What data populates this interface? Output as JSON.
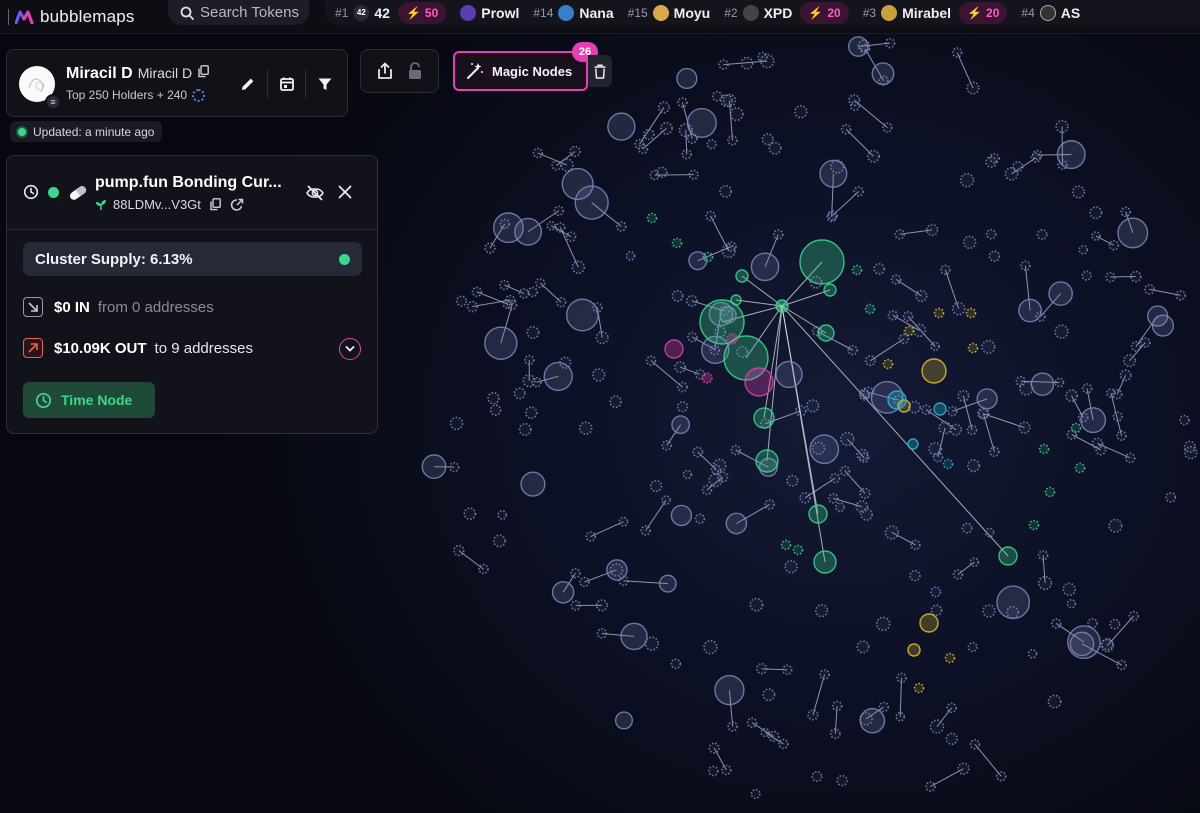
{
  "brand": {
    "name": "bubblemaps"
  },
  "search": {
    "placeholder": "Search Tokens"
  },
  "trending": [
    {
      "rank": "#1",
      "name": "42",
      "icon_text": "42",
      "icon_color": "#2a2a33",
      "boost": "50"
    },
    {
      "rank": "",
      "name": "Prowl",
      "icon_text": "",
      "icon_color": "#5b3fb0",
      "boost": ""
    },
    {
      "rank": "#14",
      "name": "Nana",
      "icon_text": "",
      "icon_color": "#3a7fc8",
      "boost": ""
    },
    {
      "rank": "#15",
      "name": "Moyu",
      "icon_text": "",
      "icon_color": "#d8a84a",
      "boost": ""
    },
    {
      "rank": "#2",
      "name": "XPD",
      "icon_text": "",
      "icon_color": "#444",
      "boost": "20"
    },
    {
      "rank": "#3",
      "name": "Mirabel",
      "icon_text": "",
      "icon_color": "#c8a040",
      "boost": "20"
    },
    {
      "rank": "#4",
      "name": "AS",
      "icon_text": "",
      "icon_color": "#333",
      "boost": ""
    }
  ],
  "token": {
    "name": "Miracil D",
    "symbol": "Miracil D",
    "subtitle": "Top 250 Holders + 240"
  },
  "updated": {
    "text": "Updated: a minute ago"
  },
  "magic_nodes": {
    "label": "Magic Nodes",
    "count": "26"
  },
  "wallet": {
    "title": "pump.fun Bonding Cur...",
    "address": "88LDMv...V3Gt",
    "cluster_supply": "Cluster Supply: 6.13%",
    "in_amount": "$0 IN",
    "in_rest": "from 0 addresses",
    "out_amount": "$10.09K OUT",
    "out_rest": "to 9 addresses",
    "time_node_label": "Time Node"
  },
  "colors": {
    "accent_pink": "#e53fb4",
    "green": "#3dd68c",
    "yellow": "#e2c12a",
    "cyan": "#2bb8d8",
    "node_default": "#7d86b8"
  }
}
